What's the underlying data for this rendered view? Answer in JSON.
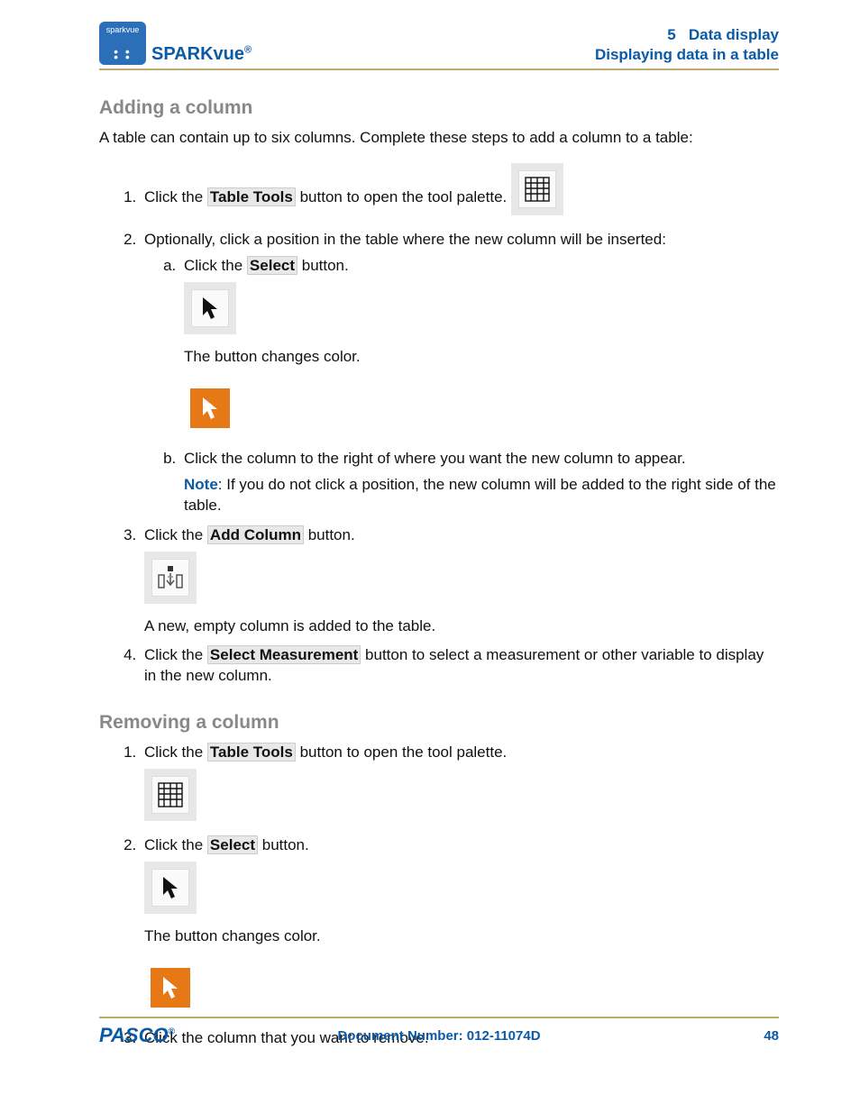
{
  "header": {
    "logo_text": "sparkvue",
    "product": "SPARKvue",
    "section_no": "5",
    "section_title": "Data display",
    "subsection": "Displaying data in a table"
  },
  "h_add": "Adding a column",
  "intro_add": "A table can contain up to six columns. Complete these steps to add a column to a table:",
  "step1_a": "Click the ",
  "btn_table_tools": "Table Tools",
  "step1_b": " button to open the tool palette.",
  "step2": "Optionally, click a position in the table where the new column will be inserted:",
  "step2a_a": "Click the ",
  "btn_select": "Select",
  "step2a_b": " button.",
  "step2a_after": "The button changes color.",
  "step2b": "Click the column to the right of where you want the new column to appear.",
  "note_label": "Note",
  "note_text": ": If you do not click a position, the new column will be added to the right side of the table.",
  "step3_a": "Click the ",
  "btn_add_column": "Add Column",
  "step3_b": " button.",
  "step3_after": "A new, empty column is added to the table.",
  "step4_a": "Click the ",
  "btn_select_meas": "Select Measurement",
  "step4_b": " button to select a measurement or other variable to display in the new column.",
  "h_remove": "Removing a column",
  "r_step1_a": "Click the ",
  "r_step1_b": " button to open the tool palette.",
  "r_step2_a": "Click the ",
  "r_step2_b": " button.",
  "r_step2_after": "The button changes color.",
  "r_step3": "Click the column that you want to remove.",
  "footer": {
    "brand": "PASCO",
    "doc_label": "Document Number: 012-11074D",
    "page": "48"
  }
}
